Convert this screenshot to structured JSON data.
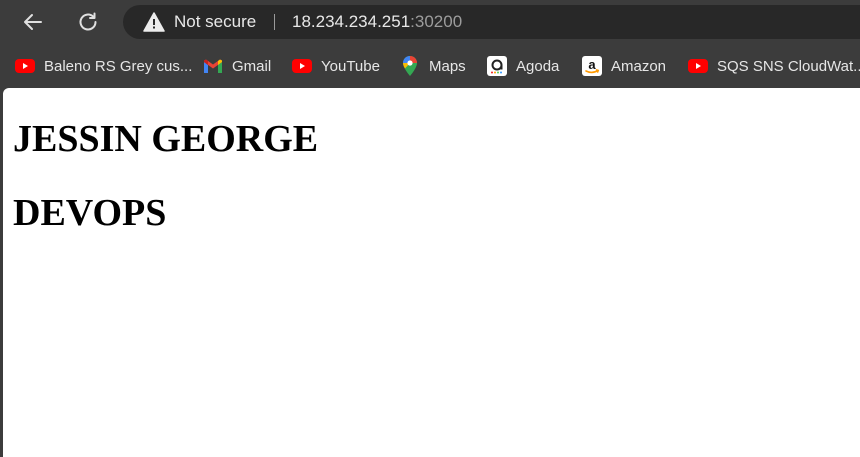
{
  "browser": {
    "security_label": "Not secure",
    "url_host": "18.234.234.251",
    "url_port": ":30200"
  },
  "bookmarks": [
    {
      "label": "Baleno RS Grey cus...",
      "icon": "youtube-icon"
    },
    {
      "label": "Gmail",
      "icon": "gmail-icon"
    },
    {
      "label": "YouTube",
      "icon": "youtube-icon"
    },
    {
      "label": "Maps",
      "icon": "maps-pin-icon"
    },
    {
      "label": "Agoda",
      "icon": "agoda-icon"
    },
    {
      "label": "Amazon",
      "icon": "amazon-icon"
    },
    {
      "label": "SQS SNS CloudWat...",
      "icon": "youtube-icon"
    }
  ],
  "page": {
    "heading_1": "JESSIN GEORGE",
    "heading_2": "DEVOPS"
  },
  "colors": {
    "chrome_bg": "#3c3c3c",
    "omnibox_bg": "#282828",
    "youtube_red": "#ff0000",
    "page_bg": "#ffffff"
  }
}
